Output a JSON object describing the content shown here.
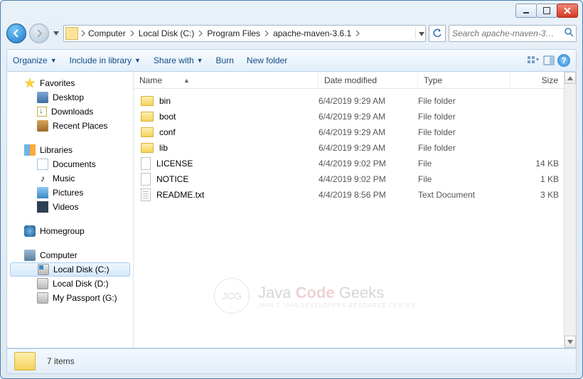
{
  "window": {
    "minimize": "",
    "maximize": "",
    "close": ""
  },
  "breadcrumb": {
    "items": [
      "Computer",
      "Local Disk (C:)",
      "Program Files",
      "apache-maven-3.6.1"
    ]
  },
  "search": {
    "placeholder": "Search apache-maven-3…"
  },
  "toolbar": {
    "organize": "Organize",
    "include": "Include in library",
    "share": "Share with",
    "burn": "Burn",
    "newfolder": "New folder"
  },
  "columns": {
    "name": "Name",
    "date": "Date modified",
    "type": "Type",
    "size": "Size"
  },
  "sidebar": {
    "favorites": {
      "label": "Favorites",
      "items": [
        "Desktop",
        "Downloads",
        "Recent Places"
      ]
    },
    "libraries": {
      "label": "Libraries",
      "items": [
        "Documents",
        "Music",
        "Pictures",
        "Videos"
      ]
    },
    "homegroup": {
      "label": "Homegroup"
    },
    "computer": {
      "label": "Computer",
      "items": [
        "Local Disk (C:)",
        "Local Disk (D:)",
        "My Passport (G:)"
      ]
    }
  },
  "files": [
    {
      "name": "bin",
      "date": "6/4/2019 9:29 AM",
      "type": "File folder",
      "size": "",
      "kind": "folder"
    },
    {
      "name": "boot",
      "date": "6/4/2019 9:29 AM",
      "type": "File folder",
      "size": "",
      "kind": "folder"
    },
    {
      "name": "conf",
      "date": "6/4/2019 9:29 AM",
      "type": "File folder",
      "size": "",
      "kind": "folder"
    },
    {
      "name": "lib",
      "date": "6/4/2019 9:29 AM",
      "type": "File folder",
      "size": "",
      "kind": "folder"
    },
    {
      "name": "LICENSE",
      "date": "4/4/2019 9:02 PM",
      "type": "File",
      "size": "14 KB",
      "kind": "file"
    },
    {
      "name": "NOTICE",
      "date": "4/4/2019 9:02 PM",
      "type": "File",
      "size": "1 KB",
      "kind": "file"
    },
    {
      "name": "README.txt",
      "date": "4/4/2019 8:56 PM",
      "type": "Text Document",
      "size": "3 KB",
      "kind": "txt"
    }
  ],
  "status": {
    "count_label": "7 items"
  },
  "watermark": {
    "badge": "JCG",
    "line1_a": "Java ",
    "line1_b": "Code",
    "line1_c": " Geeks",
    "line2": "Java 2 Java Developers Resource Center"
  }
}
